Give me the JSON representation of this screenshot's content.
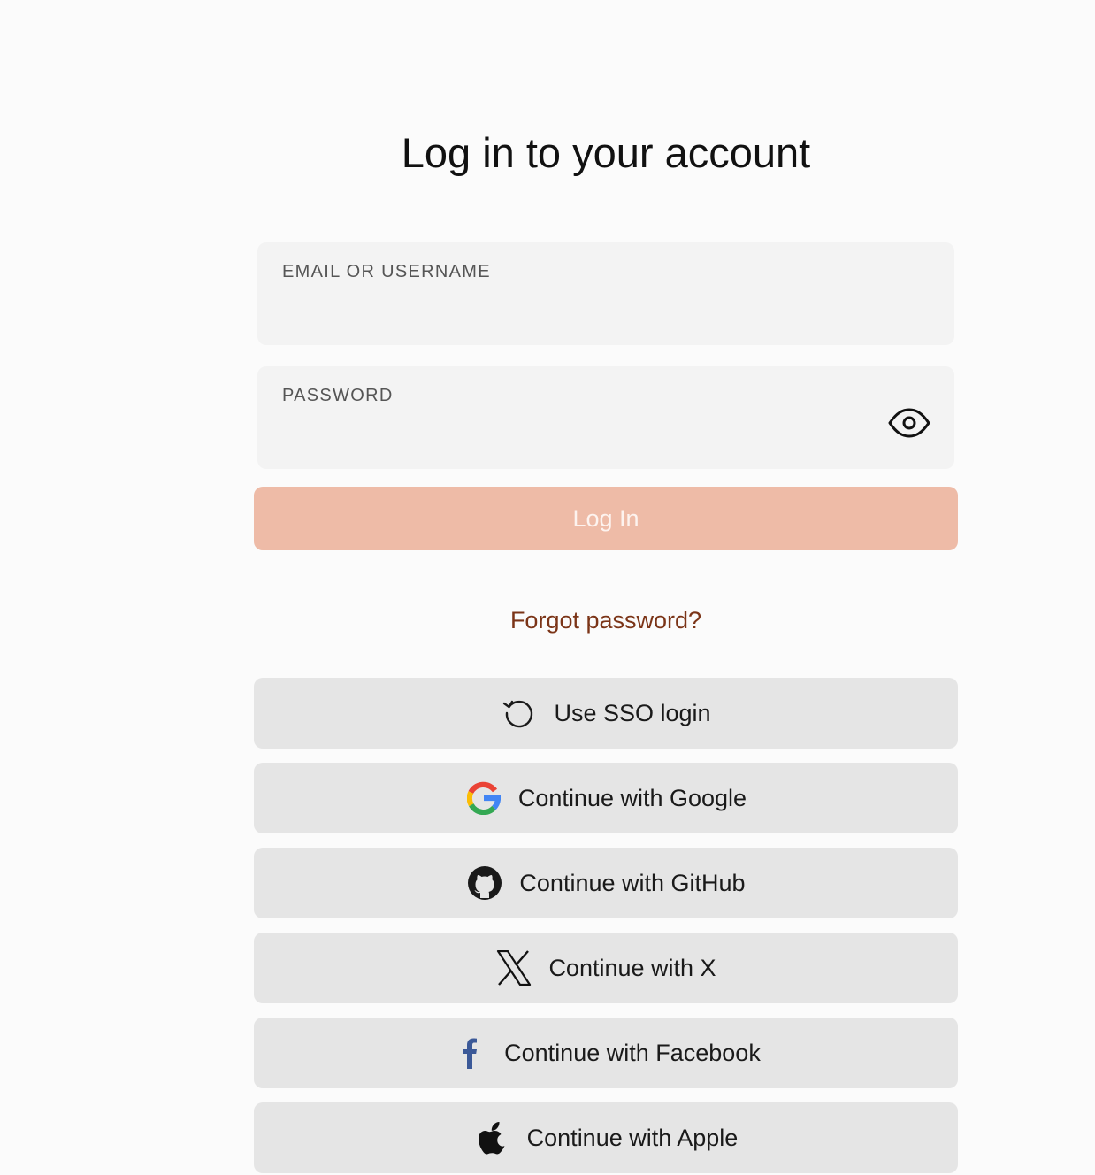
{
  "title": "Log in to your account",
  "email": {
    "label": "EMAIL OR USERNAME",
    "value": ""
  },
  "password": {
    "label": "PASSWORD",
    "value": ""
  },
  "login_button": "Log In",
  "forgot_link": "Forgot password?",
  "providers": [
    {
      "label": "Use SSO login",
      "icon": "history-icon"
    },
    {
      "label": "Continue with Google",
      "icon": "google-icon"
    },
    {
      "label": "Continue with GitHub",
      "icon": "github-icon"
    },
    {
      "label": "Continue with X",
      "icon": "x-icon"
    },
    {
      "label": "Continue with Facebook",
      "icon": "facebook-icon"
    },
    {
      "label": "Continue with Apple",
      "icon": "apple-icon"
    }
  ],
  "colors": {
    "background": "#fbfbfb",
    "field": "#f3f3f3",
    "login_button": "#eebba7",
    "forgot_link": "#7b3417",
    "social_button": "#e5e5e5",
    "facebook": "#3b5998"
  }
}
